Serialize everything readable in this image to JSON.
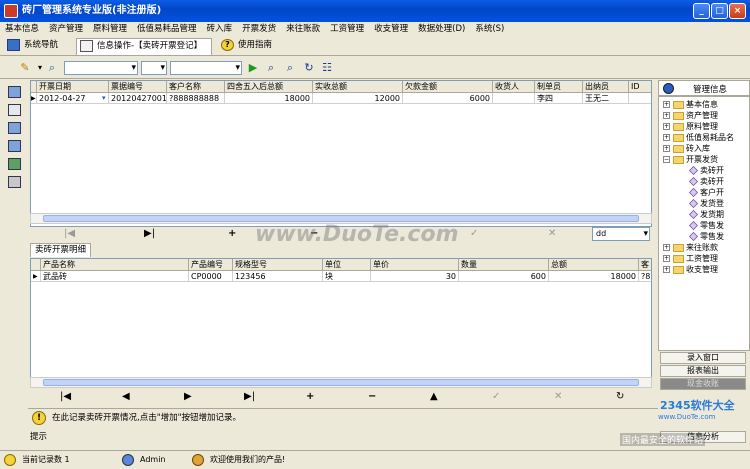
{
  "window": {
    "title": "砖厂管理系统专业版(非注册版)",
    "btn_min": "_",
    "btn_max": "□",
    "btn_close": "×"
  },
  "menu": [
    "基本信息",
    "资产管理",
    "原料管理",
    "低值易耗品管理",
    "砖入库",
    "开票发货",
    "来往账款",
    "工资管理",
    "收支管理",
    "数据处理(D)",
    "系统(S)"
  ],
  "tabs": [
    {
      "label": "系统导航"
    },
    {
      "label": "信息操作-【卖砖开票登记】"
    },
    {
      "label": "使用指南"
    }
  ],
  "toolbar": {
    "combo1": "",
    "combo2": "",
    "combo3": ""
  },
  "main_grid": {
    "columns": [
      "开票日期",
      "票据编号",
      "客户名称",
      "四舍五入后总额",
      "实收总额",
      "欠款金额",
      "收货人",
      "制单员",
      "出纳员",
      "ID"
    ],
    "rows": [
      [
        "2012-04-27",
        "20120427001",
        "?888888888",
        "18000",
        "12000",
        "6000",
        "",
        "李四",
        "王无二",
        ""
      ]
    ]
  },
  "nav1": {
    "first": "|◀",
    "last": "▶|",
    "add": "+",
    "del": "−",
    "up": "▲",
    "ok": "✓",
    "cancel": "✕",
    "filter_value": "dd"
  },
  "detail_tab": "卖砖开票明细",
  "detail_grid": {
    "columns": [
      "产品名称",
      "产品编号",
      "规格型号",
      "单位",
      "单价",
      "数量",
      "总额",
      "客"
    ],
    "rows": [
      [
        "武品砖",
        "CP0000",
        "123456",
        "块",
        "30",
        "600",
        "18000",
        "?8"
      ]
    ]
  },
  "nav2": {
    "first": "|◀",
    "prev": "◀",
    "next": "▶",
    "last": "▶|",
    "add": "+",
    "del": "−",
    "up": "▲",
    "ok": "✓",
    "cancel": "✕",
    "refresh": "↻"
  },
  "tip": {
    "text": "在此记录卖砖开票情况,点击\"增加\"按钮增加记录。",
    "label": "提示"
  },
  "right_panel": {
    "title": "管理信息",
    "tree": [
      {
        "label": "基本信息",
        "level": 0,
        "expanded": false
      },
      {
        "label": "资产管理",
        "level": 0,
        "expanded": false
      },
      {
        "label": "原料管理",
        "level": 0,
        "expanded": false
      },
      {
        "label": "低值易耗品名",
        "level": 0,
        "expanded": false
      },
      {
        "label": "砖入库",
        "level": 0,
        "expanded": false
      },
      {
        "label": "开票发货",
        "level": 0,
        "expanded": true
      },
      {
        "label": "卖砖开",
        "level": 1
      },
      {
        "label": "卖砖开",
        "level": 1
      },
      {
        "label": "客户开",
        "level": 1
      },
      {
        "label": "发货登",
        "level": 1
      },
      {
        "label": "发货期",
        "level": 1
      },
      {
        "label": "零售发",
        "level": 1
      },
      {
        "label": "零售发",
        "level": 1
      },
      {
        "label": "来往账款",
        "level": 0,
        "expanded": false
      },
      {
        "label": "工资管理",
        "level": 0,
        "expanded": false
      },
      {
        "label": "收支管理",
        "level": 0,
        "expanded": false
      }
    ],
    "buttons": [
      "录入窗口",
      "报表输出",
      "现金收账",
      "信息分析"
    ]
  },
  "status": {
    "records": "当前记录数 1",
    "user": "Admin",
    "welcome": "欢迎使用我们的产品!"
  },
  "watermark": {
    "main": "www.DuoTe.com",
    "site": "www.DuoTe.com",
    "brand": "2345软件大全",
    "sub": "国内最安全的软件站"
  },
  "colors": {
    "titlebar": "#0346C8",
    "window_bg": "#ECE9D8",
    "grid_border": "#7F9DB9",
    "selection": "#316AC5"
  }
}
